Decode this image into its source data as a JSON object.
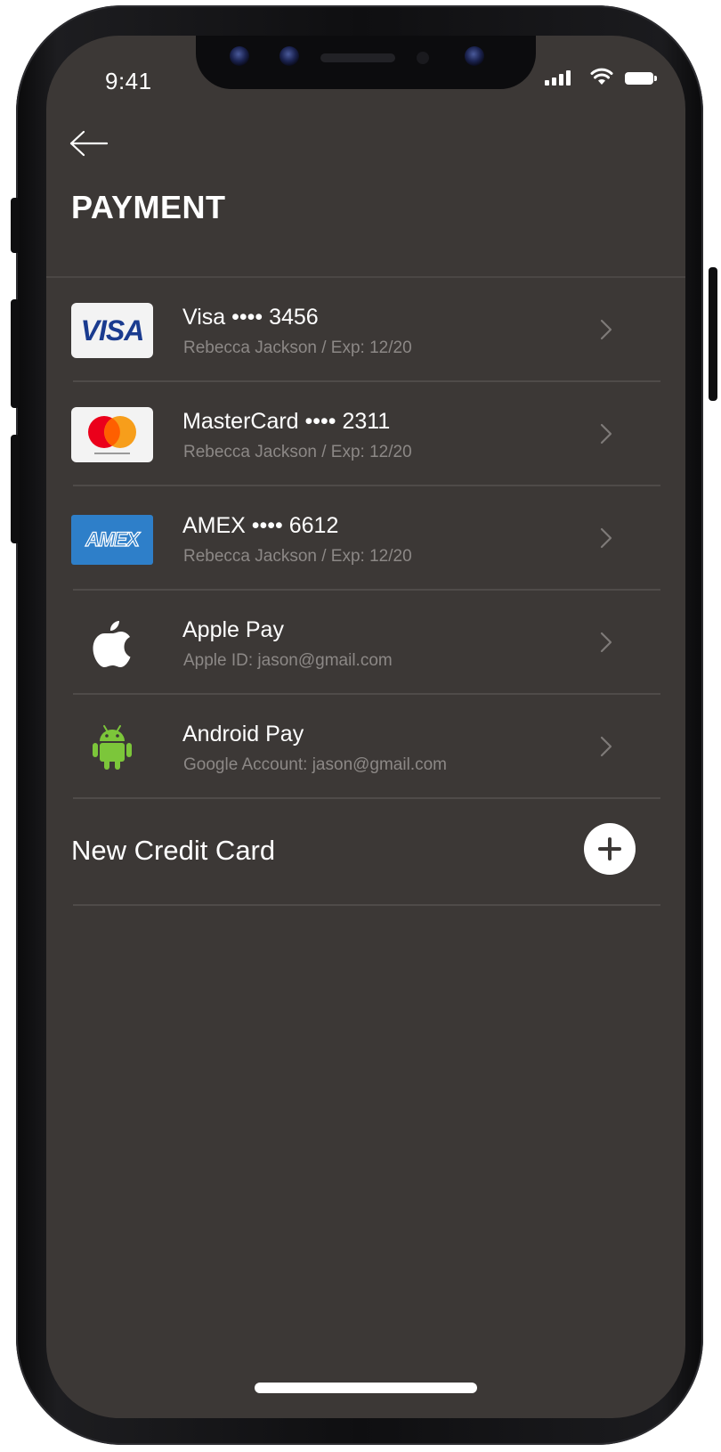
{
  "status_bar": {
    "time": "9:41"
  },
  "header": {
    "back_icon": "arrow-left-icon",
    "title": "PAYMENT"
  },
  "payment_methods": [
    {
      "logo": "VISA",
      "title": "Visa •••• 3456",
      "subtitle": "Rebecca Jackson  /  Exp: 12/20"
    },
    {
      "logo": "mastercard-logo",
      "title": "MasterCard •••• 2311",
      "subtitle": "Rebecca Jackson  /  Exp: 12/20"
    },
    {
      "logo": "AMEX",
      "title": "AMEX •••• 6612",
      "subtitle": "Rebecca Jackson  /  Exp: 12/20"
    },
    {
      "logo": "apple-logo-icon",
      "title": "Apple Pay",
      "subtitle": "Apple ID: jason@gmail.com"
    },
    {
      "logo": "android-logo-icon",
      "title": "Android Pay",
      "subtitle": "Google Account: jason@gmail.com"
    }
  ],
  "add_card": {
    "label": "New Credit Card",
    "icon": "plus-icon"
  },
  "colors": {
    "screen_background": "#3c3836",
    "divider": "#4f4b49",
    "primary_text": "#ffffff",
    "secondary_text": "#8c8886",
    "amex_blue": "#2e7fc9",
    "android_green": "#7cc63a",
    "mastercard_red": "#eb001b",
    "mastercard_orange": "#f79e1b"
  }
}
